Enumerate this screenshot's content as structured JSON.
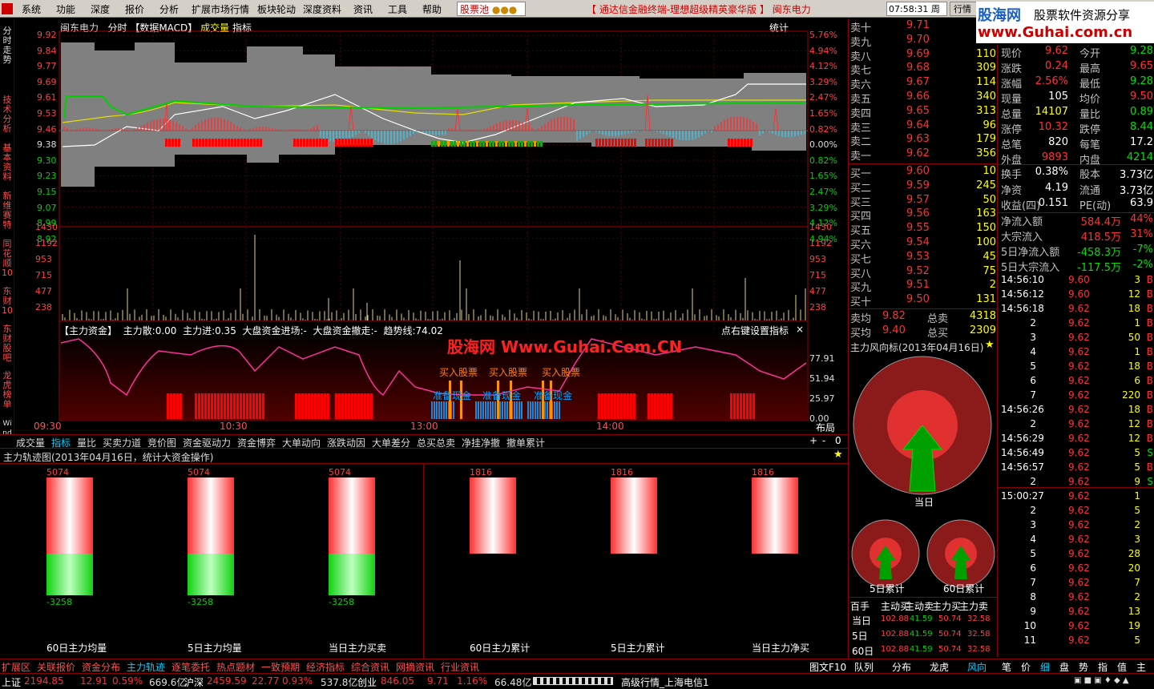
{
  "menu": {
    "items": [
      "系统",
      "功能",
      "深度",
      "报价",
      "分析",
      "扩展市场行情",
      "板块轮动",
      "深度资料",
      "资讯",
      "工具",
      "帮助"
    ],
    "pool": "股票池",
    "marquee": "【 通达信金融终端-理想超级精英豪华版 】  闽东电力",
    "time": "07:58:31",
    "weekday": "周三",
    "market": "行情",
    "logo_title": "股海网",
    "logo_sub": "股票软件资源分享",
    "logo_url": "www.Guhai.com.cn"
  },
  "side_tabs": [
    "分时走势",
    "技术分析",
    "基本资料",
    "新维赛特",
    "同花顺10",
    "东财10",
    "东财股吧",
    "龙虎榜单",
    "Wind资讯"
  ],
  "chart_header": {
    "name": "闽东电力",
    "mode": "分时",
    "macd": "【数据MACD】",
    "vol": "成交量",
    "indicator": "指标",
    "stat": "统计"
  },
  "price_axis": {
    "left": [
      "9.92",
      "9.84",
      "9.77",
      "9.69",
      "9.61",
      "9.53",
      "9.46",
      "9.38",
      "9.30",
      "9.23",
      "9.15",
      "9.07",
      "8.99",
      "8.92"
    ],
    "right": [
      "5.76%",
      "4.94%",
      "4.12%",
      "3.29%",
      "2.47%",
      "1.65%",
      "0.82%",
      "0.00%",
      "0.82%",
      "1.65%",
      "2.47%",
      "3.29%",
      "4.12%",
      "4.94%"
    ]
  },
  "vol_axis": [
    "1430",
    "1192",
    "953",
    "715",
    "477",
    "238"
  ],
  "fund_header": {
    "title": "【主力资金】",
    "a": "主力散:0.00",
    "b": "主力进:0.35",
    "c": "大盘资金进场:-",
    "d": "大盘资金撤走:-",
    "e": "趋势线:74.02",
    "tip": "点右键设置指标"
  },
  "fund_axis": [
    "77.91",
    "51.94",
    "25.97",
    "0.00"
  ],
  "watermark": "股海网 Www.Guhai.Com.CN",
  "signals": {
    "buy": "买入股票",
    "ready": "准备现金"
  },
  "time_axis": [
    "09:30",
    "10:30",
    "13:00",
    "14:00"
  ],
  "layout_label": "布局",
  "ladder": {
    "sell": [
      [
        "卖十",
        "9.71",
        ""
      ],
      [
        "卖九",
        "9.70",
        ""
      ],
      [
        "卖八",
        "9.69",
        "110"
      ],
      [
        "卖七",
        "9.68",
        "309"
      ],
      [
        "卖六",
        "9.67",
        "114"
      ],
      [
        "卖五",
        "9.66",
        "340"
      ],
      [
        "卖四",
        "9.65",
        "313"
      ],
      [
        "卖三",
        "9.64",
        "96"
      ],
      [
        "卖二",
        "9.63",
        "179"
      ],
      [
        "卖一",
        "9.62",
        "356"
      ]
    ],
    "buy": [
      [
        "买一",
        "9.60",
        "10"
      ],
      [
        "买二",
        "9.59",
        "245"
      ],
      [
        "买三",
        "9.57",
        "50"
      ],
      [
        "买四",
        "9.56",
        "163"
      ],
      [
        "买五",
        "9.55",
        "150"
      ],
      [
        "买六",
        "9.54",
        "100"
      ],
      [
        "买七",
        "9.53",
        "45"
      ],
      [
        "买八",
        "9.52",
        "75"
      ],
      [
        "买九",
        "9.51",
        "2"
      ],
      [
        "买十",
        "9.50",
        "131"
      ]
    ],
    "avg": [
      [
        "卖均",
        "9.82",
        "总卖",
        "4318"
      ],
      [
        "买均",
        "9.40",
        "总买",
        "2309"
      ]
    ]
  },
  "quote": [
    [
      "现价",
      "9.62",
      "今开",
      "9.28"
    ],
    [
      "涨跌",
      "0.24",
      "最高",
      "9.65"
    ],
    [
      "涨幅",
      "2.56%",
      "最低",
      "9.28"
    ],
    [
      "现量",
      "105",
      "均价",
      "9.50"
    ],
    [
      "总量",
      "14107",
      "量比",
      "0.89"
    ],
    [
      "涨停",
      "10.32",
      "跌停",
      "8.44"
    ],
    [
      "总笔",
      "820",
      "每笔",
      "17.2"
    ],
    [
      "外盘",
      "9893",
      "内盘",
      "4214"
    ],
    [
      "换手",
      "0.38%",
      "股本",
      "3.73亿"
    ],
    [
      "净资",
      "4.19",
      "流通",
      "3.73亿"
    ],
    [
      "收益(四)",
      "0.151",
      "PE(动)",
      "63.9"
    ]
  ],
  "flows": [
    [
      "净流入额",
      "584.4万",
      "44%"
    ],
    [
      "大宗流入",
      "418.5万",
      "31%"
    ],
    [
      "5日净流入额",
      "-458.3万",
      "-7%"
    ],
    [
      "5日大宗流入",
      "-117.5万",
      "-2%"
    ]
  ],
  "ticks": [
    [
      "14:56:10",
      "9.60",
      "3",
      "B"
    ],
    [
      "14:56:12",
      "9.60",
      "12",
      "B"
    ],
    [
      "14:56:18",
      "9.62",
      "18",
      "B"
    ],
    [
      "2",
      "9.62",
      "1",
      "B"
    ],
    [
      "3",
      "9.62",
      "50",
      "B"
    ],
    [
      "4",
      "9.62",
      "1",
      "B"
    ],
    [
      "5",
      "9.62",
      "18",
      "B"
    ],
    [
      "6",
      "9.62",
      "6",
      "B"
    ],
    [
      "7",
      "9.62",
      "220",
      "B"
    ],
    [
      "14:56:26",
      "9.62",
      "18",
      "B"
    ],
    [
      "2",
      "9.62",
      "12",
      "B"
    ],
    [
      "14:56:29",
      "9.62",
      "12",
      "B"
    ],
    [
      "14:56:49",
      "9.62",
      "5",
      "S"
    ],
    [
      "14:56:57",
      "9.62",
      "5",
      "B"
    ],
    [
      "2",
      "9.62",
      "9",
      "S"
    ],
    [
      "15:00:27",
      "9.62",
      "1",
      ""
    ],
    [
      "2",
      "9.62",
      "5",
      ""
    ],
    [
      "3",
      "9.62",
      "2",
      ""
    ],
    [
      "4",
      "9.62",
      "3",
      ""
    ],
    [
      "5",
      "9.62",
      "28",
      ""
    ],
    [
      "6",
      "9.62",
      "20",
      ""
    ],
    [
      "7",
      "9.62",
      "7",
      ""
    ],
    [
      "8",
      "9.62",
      "2",
      ""
    ],
    [
      "9",
      "9.62",
      "13",
      ""
    ],
    [
      "10",
      "9.62",
      "19",
      ""
    ],
    [
      "11",
      "9.62",
      "5",
      ""
    ]
  ],
  "bottom_tabs": [
    "成交量",
    "指标",
    "量比",
    "买卖力道",
    "竞价图",
    "资金驱动力",
    "资金博弈",
    "大单动向",
    "涨跌动因",
    "大单差分",
    "总买总卖",
    "净挂净撤",
    "撤单累计"
  ],
  "lower": {
    "title": "主力轨迹图(2013年04月16日，统计大资金操作)",
    "bars": [
      {
        "top": "5074",
        "bot": "-3258",
        "label": "60日主力均量"
      },
      {
        "top": "5074",
        "bot": "-3258",
        "label": "5日主力均量"
      },
      {
        "top": "5074",
        "bot": "-3258",
        "label": "当日主力买卖"
      },
      {
        "top": "1816",
        "bot": "",
        "label": "60日主力累计"
      },
      {
        "top": "1816",
        "bot": "",
        "label": "5日主力累计"
      },
      {
        "top": "1816",
        "bot": "",
        "label": "当日主力净买"
      }
    ]
  },
  "wind": {
    "title": "主力风向标(2013年04月16日)",
    "today": "当日",
    "d5": "5日累计",
    "d60": "60日累计",
    "table_head": [
      "百手",
      "主动买",
      "主动卖",
      "主力买",
      "主力卖"
    ],
    "rows": [
      [
        "当日",
        "102.88",
        "41.59",
        "50.74",
        "32.58"
      ],
      [
        "5日",
        "102.88",
        "41.59",
        "50.74",
        "32.58"
      ],
      [
        "60日",
        "102.88",
        "41.59",
        "50.74",
        "32.58"
      ]
    ]
  },
  "ext_tabs": [
    "扩展区",
    "关联报价",
    "资金分布",
    "主力轨迹",
    "逐笔委托",
    "热点题材",
    "一致预期",
    "经济指标",
    "综合资讯",
    "网摘资讯",
    "行业资讯"
  ],
  "right_tabs": [
    "队列",
    "分布",
    "龙虎",
    "风向"
  ],
  "tiny_tabs": [
    "笔",
    "价",
    "细",
    "盘",
    "势",
    "指",
    "值",
    "主"
  ],
  "tuwen": "图文F10",
  "status": {
    "sh": "上证",
    "sh_v": "2194.85",
    "sh_c": "12.91",
    "sh_p": "0.59%",
    "sh_a": "669.6亿",
    "hs": "沪深",
    "hs_v": "2459.59",
    "hs_c": "22.77",
    "hs_p": "0.93%",
    "hs_a": "537.8亿",
    "cy": "创业",
    "cy_v": "846.05",
    "cy_c": "9.71",
    "cy_p": "1.16%",
    "cy_a": "66.48亿",
    "adv": "高级行情_上海电信1"
  }
}
